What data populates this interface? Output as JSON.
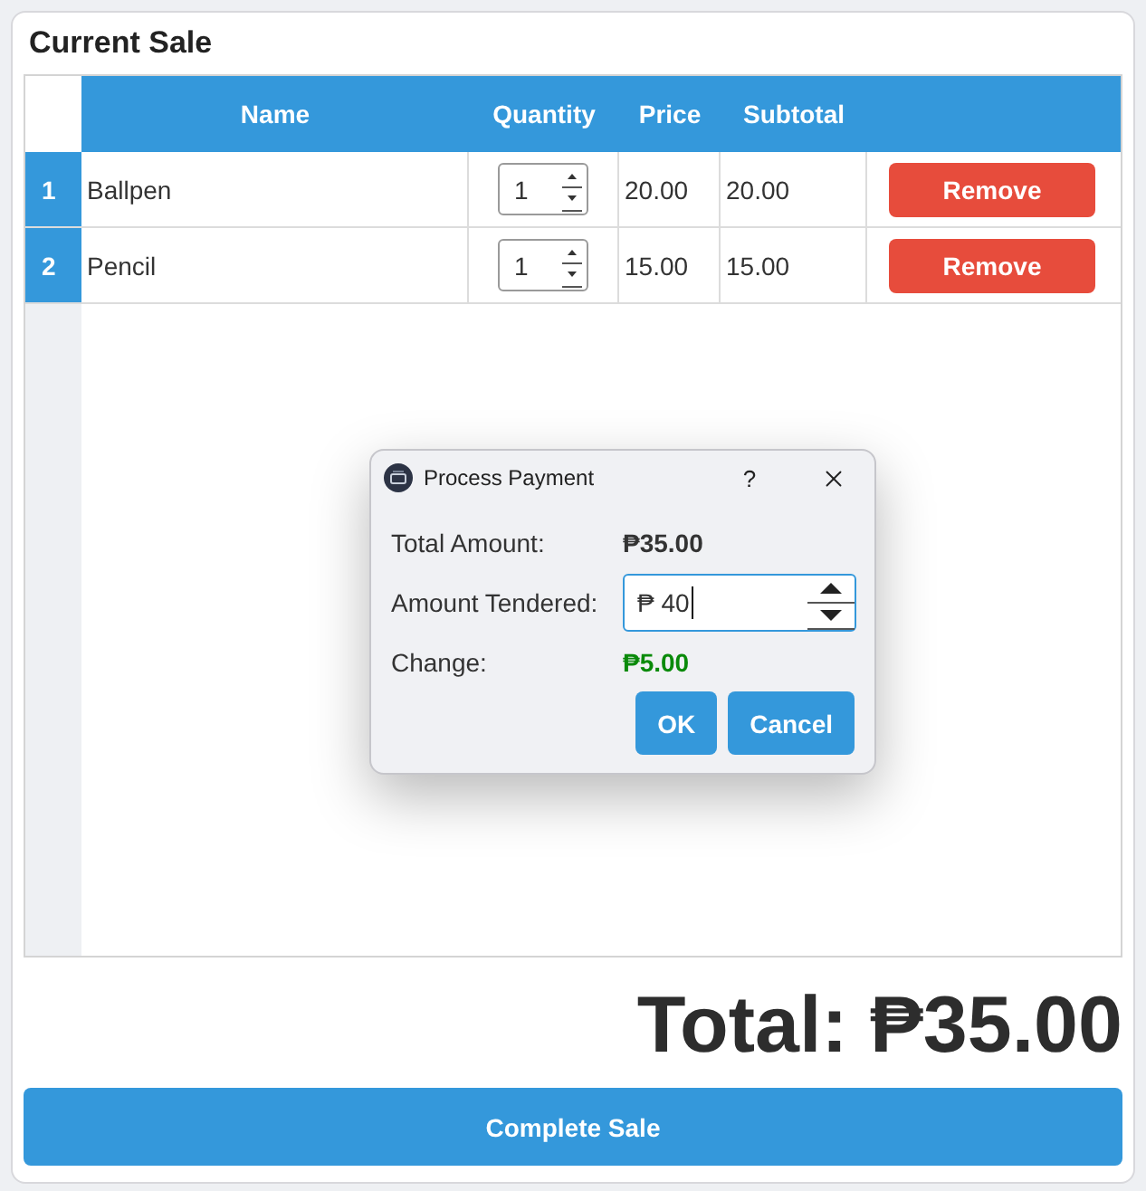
{
  "panel": {
    "title": "Current Sale"
  },
  "table": {
    "columns": [
      "Name",
      "Quantity",
      "Price",
      "Subtotal"
    ],
    "rows": [
      {
        "number": "1",
        "name": "Ballpen",
        "quantity": "1",
        "price": "20.00",
        "subtotal": "20.00",
        "action": "Remove"
      },
      {
        "number": "2",
        "name": "Pencil",
        "quantity": "1",
        "price": "15.00",
        "subtotal": "15.00",
        "action": "Remove"
      }
    ]
  },
  "dialog": {
    "title": "Process Payment",
    "help_button": "?",
    "rows": [
      {
        "kind": "amount",
        "label": "Total Amount:",
        "value": "₱35.00"
      },
      {
        "kind": "input",
        "label": "Amount Tendered:",
        "value": "₱ 40",
        "focused": true
      },
      {
        "kind": "change",
        "label": "Change:",
        "value": "₱5.00"
      }
    ],
    "buttons": [
      "OK",
      "Cancel"
    ]
  },
  "total": "Total: ₱35.00",
  "complete_button": "Complete Sale"
}
